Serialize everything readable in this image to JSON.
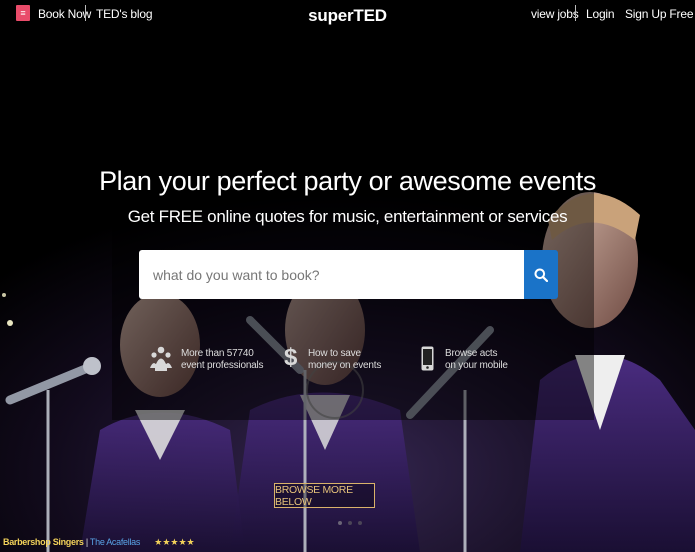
{
  "header": {
    "menu_icon": "menu-icon",
    "book_now": "Book Now",
    "blog": "TED's blog",
    "brand": "superTED",
    "view_jobs": "view jobs",
    "login": "Login",
    "signup": "Sign Up Free"
  },
  "hero": {
    "title": "Plan your perfect party or awesome events",
    "subtitle": "Get FREE online quotes for music, entertainment or services"
  },
  "search": {
    "placeholder": "what do you want to book?",
    "value": "",
    "button_icon": "search-icon"
  },
  "features": [
    {
      "icon": "people-icon",
      "line1": "More than 57740",
      "line2": "event professionals"
    },
    {
      "icon": "dollar-icon",
      "line1": "How to save",
      "line2": "money on events"
    },
    {
      "icon": "mobile-icon",
      "line1": "Browse acts",
      "line2": "on your mobile"
    }
  ],
  "browse": {
    "label": "BROWSE MORE BELOW"
  },
  "caption": {
    "title": "Barbershop Singers",
    "separator": "|",
    "act": "The Acafellas",
    "stars": "★★★★★"
  },
  "colors": {
    "menu_accent": "#e94c6a",
    "search_button": "#1a73c8",
    "browse_border": "#d9b26a",
    "caption_title": "#f2d25a",
    "caption_link": "#59a3e6"
  }
}
